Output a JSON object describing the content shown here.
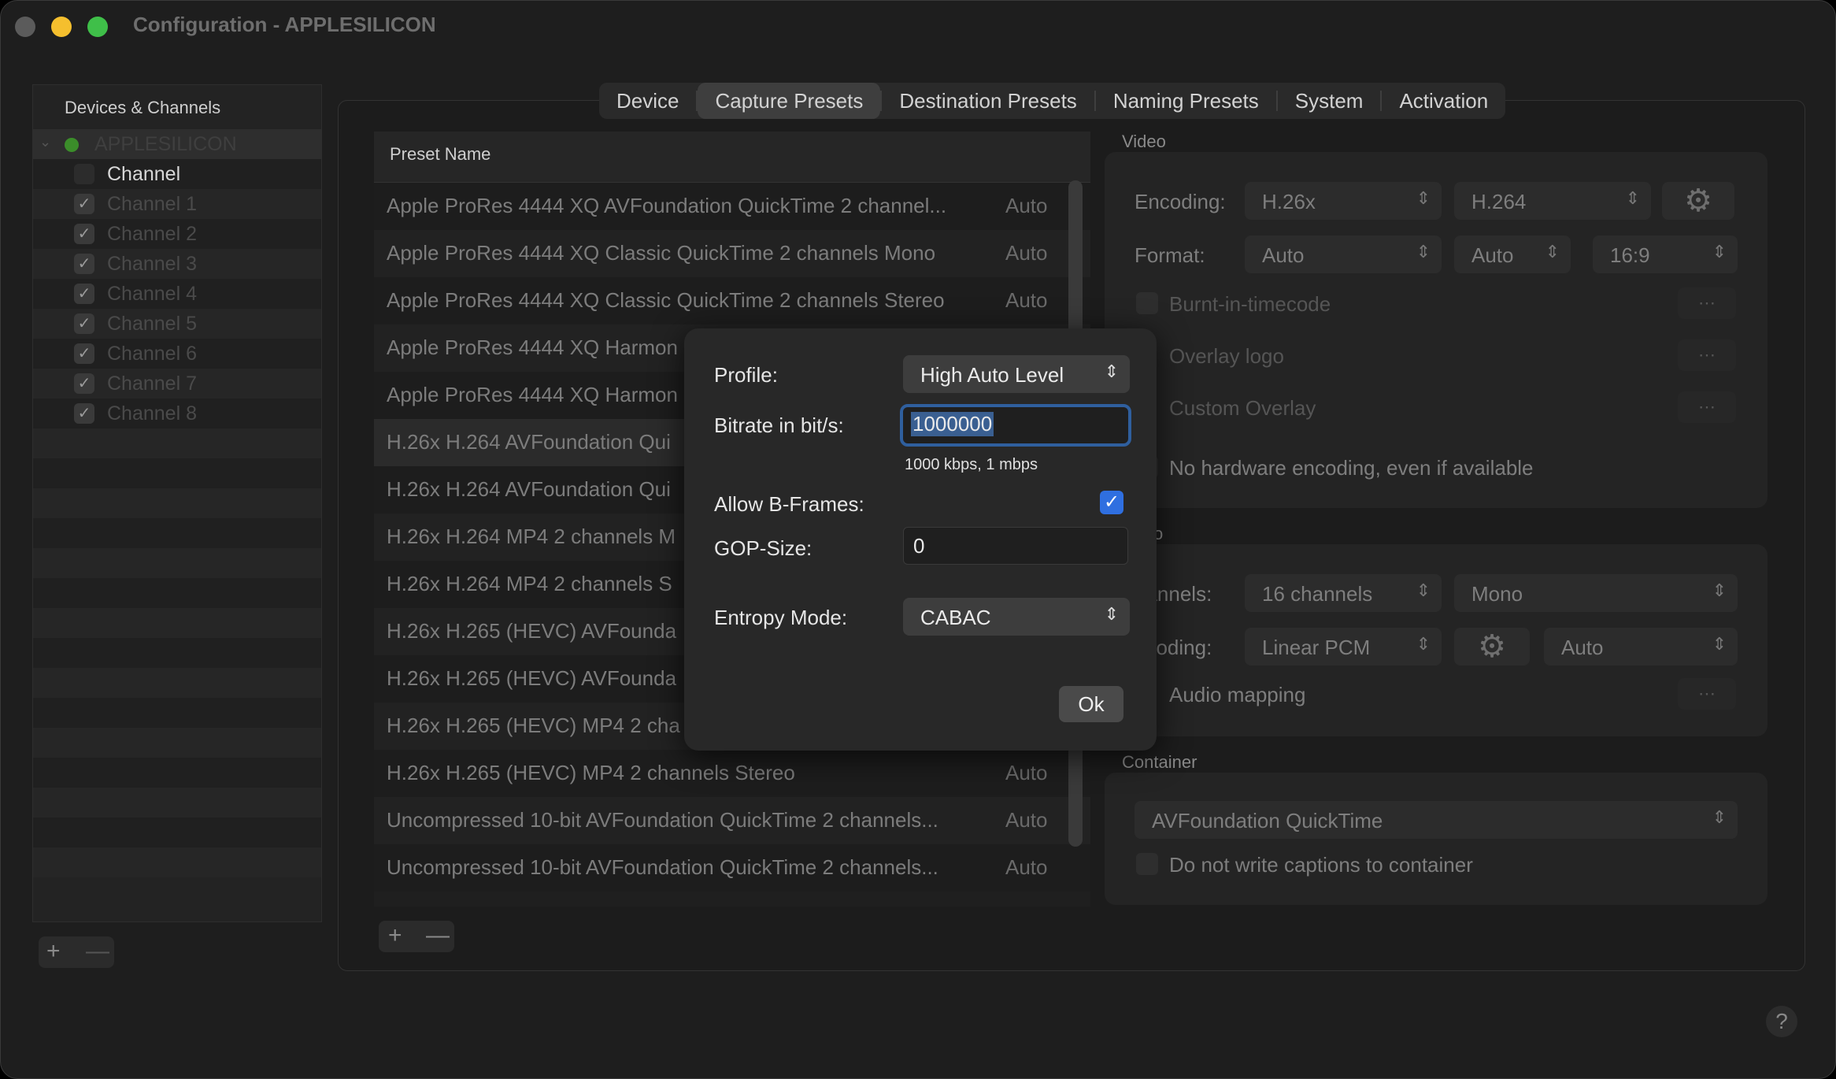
{
  "window": {
    "title": "Configuration - APPLESILICON",
    "colors": {
      "close": "#5b5b5b",
      "minimize": "#f5bf2e",
      "maximize": "#3fbf49"
    }
  },
  "sidebar": {
    "header": "Devices & Channels",
    "device": "APPLESILICON",
    "items": [
      {
        "label": "Channel",
        "checked": false
      },
      {
        "label": "Channel 1",
        "checked": true
      },
      {
        "label": "Channel 2",
        "checked": true
      },
      {
        "label": "Channel 3",
        "checked": true
      },
      {
        "label": "Channel 4",
        "checked": true
      },
      {
        "label": "Channel 5",
        "checked": true
      },
      {
        "label": "Channel 6",
        "checked": true
      },
      {
        "label": "Channel 7",
        "checked": true
      },
      {
        "label": "Channel 8",
        "checked": true
      }
    ],
    "add": "+",
    "remove": "—"
  },
  "tabs": [
    "Device",
    "Capture Presets",
    "Destination Presets",
    "Naming Presets",
    "System",
    "Activation"
  ],
  "table": {
    "header": "Preset Name",
    "rows": [
      {
        "name": "Apple ProRes 4444 XQ AVFoundation QuickTime 2 channel...",
        "value": "Auto"
      },
      {
        "name": "Apple ProRes 4444 XQ Classic QuickTime 2 channels Mono",
        "value": "Auto"
      },
      {
        "name": "Apple ProRes 4444 XQ Classic QuickTime 2 channels Stereo",
        "value": "Auto"
      },
      {
        "name": "Apple ProRes 4444 XQ Harmon",
        "value": ""
      },
      {
        "name": "Apple ProRes 4444 XQ Harmon",
        "value": ""
      },
      {
        "name": "H.26x H.264 AVFoundation Qui",
        "value": ""
      },
      {
        "name": "H.26x H.264 AVFoundation Qui",
        "value": ""
      },
      {
        "name": "H.26x H.264 MP4 2 channels M",
        "value": ""
      },
      {
        "name": "H.26x H.264 MP4 2 channels S",
        "value": ""
      },
      {
        "name": "H.26x H.265 (HEVC) AVFounda",
        "value": ""
      },
      {
        "name": "H.26x H.265 (HEVC) AVFounda",
        "value": ""
      },
      {
        "name": "H.26x H.265 (HEVC) MP4 2 cha",
        "value": ""
      },
      {
        "name": "H.26x H.265 (HEVC) MP4 2 channels Stereo",
        "value": "Auto"
      },
      {
        "name": "Uncompressed 10-bit AVFoundation QuickTime 2 channels...",
        "value": "Auto"
      },
      {
        "name": "Uncompressed 10-bit AVFoundation QuickTime 2 channels...",
        "value": "Auto"
      }
    ],
    "add": "+",
    "remove": "—"
  },
  "video": {
    "label": "Video",
    "encoding_label": "Encoding:",
    "encoding": "H.26x",
    "codec": "H.264",
    "format_label": "Format:",
    "format": "Auto",
    "format2": "Auto",
    "aspect": "16:9",
    "burnt_in": "Burnt-in-timecode",
    "overlay_logo": "Overlay logo",
    "custom_overlay": "Custom Overlay",
    "no_hw": "No hardware encoding, even if available"
  },
  "audio": {
    "label": "o",
    "channels_label": "nannels:",
    "channels": "16 channels",
    "mode": "Mono",
    "encoding_label": "ncoding:",
    "encoding": "Linear PCM",
    "rate": "Auto",
    "mapping": "Audio mapping"
  },
  "container": {
    "label": "Container",
    "value": "AVFoundation QuickTime",
    "no_captions": "Do not write captions to container"
  },
  "dialog": {
    "profile_label": "Profile:",
    "profile": "High Auto Level",
    "bitrate_label": "Bitrate in bit/s:",
    "bitrate": "1000000",
    "bitrate_hint": "1000 kbps, 1 mbps",
    "bframes_label": "Allow B-Frames:",
    "bframes": true,
    "gop_label": "GOP-Size:",
    "gop": "0",
    "entropy_label": "Entropy Mode:",
    "entropy": "CABAC",
    "ok": "Ok"
  },
  "help": "?"
}
